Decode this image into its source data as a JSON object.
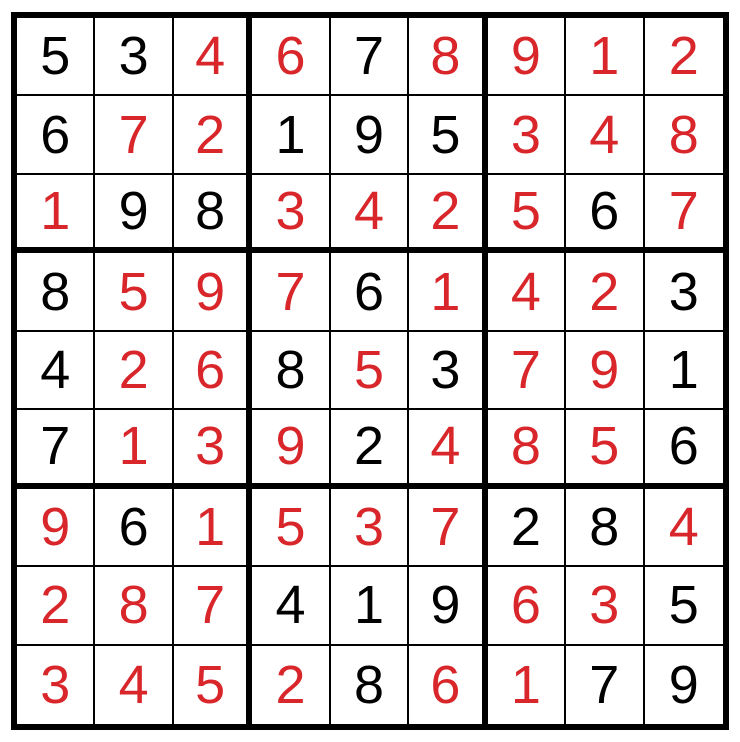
{
  "chart_data": {
    "type": "table",
    "title": "Sudoku Grid",
    "rows": [
      [
        {
          "v": 5,
          "given": true
        },
        {
          "v": 3,
          "given": true
        },
        {
          "v": 4,
          "given": false
        },
        {
          "v": 6,
          "given": false
        },
        {
          "v": 7,
          "given": true
        },
        {
          "v": 8,
          "given": false
        },
        {
          "v": 9,
          "given": false
        },
        {
          "v": 1,
          "given": false
        },
        {
          "v": 2,
          "given": false
        }
      ],
      [
        {
          "v": 6,
          "given": true
        },
        {
          "v": 7,
          "given": false
        },
        {
          "v": 2,
          "given": false
        },
        {
          "v": 1,
          "given": true
        },
        {
          "v": 9,
          "given": true
        },
        {
          "v": 5,
          "given": true
        },
        {
          "v": 3,
          "given": false
        },
        {
          "v": 4,
          "given": false
        },
        {
          "v": 8,
          "given": false
        }
      ],
      [
        {
          "v": 1,
          "given": false
        },
        {
          "v": 9,
          "given": true
        },
        {
          "v": 8,
          "given": true
        },
        {
          "v": 3,
          "given": false
        },
        {
          "v": 4,
          "given": false
        },
        {
          "v": 2,
          "given": false
        },
        {
          "v": 5,
          "given": false
        },
        {
          "v": 6,
          "given": true
        },
        {
          "v": 7,
          "given": false
        }
      ],
      [
        {
          "v": 8,
          "given": true
        },
        {
          "v": 5,
          "given": false
        },
        {
          "v": 9,
          "given": false
        },
        {
          "v": 7,
          "given": false
        },
        {
          "v": 6,
          "given": true
        },
        {
          "v": 1,
          "given": false
        },
        {
          "v": 4,
          "given": false
        },
        {
          "v": 2,
          "given": false
        },
        {
          "v": 3,
          "given": true
        }
      ],
      [
        {
          "v": 4,
          "given": true
        },
        {
          "v": 2,
          "given": false
        },
        {
          "v": 6,
          "given": false
        },
        {
          "v": 8,
          "given": true
        },
        {
          "v": 5,
          "given": false
        },
        {
          "v": 3,
          "given": true
        },
        {
          "v": 7,
          "given": false
        },
        {
          "v": 9,
          "given": false
        },
        {
          "v": 1,
          "given": true
        }
      ],
      [
        {
          "v": 7,
          "given": true
        },
        {
          "v": 1,
          "given": false
        },
        {
          "v": 3,
          "given": false
        },
        {
          "v": 9,
          "given": false
        },
        {
          "v": 2,
          "given": true
        },
        {
          "v": 4,
          "given": false
        },
        {
          "v": 8,
          "given": false
        },
        {
          "v": 5,
          "given": false
        },
        {
          "v": 6,
          "given": true
        }
      ],
      [
        {
          "v": 9,
          "given": false
        },
        {
          "v": 6,
          "given": true
        },
        {
          "v": 1,
          "given": false
        },
        {
          "v": 5,
          "given": false
        },
        {
          "v": 3,
          "given": false
        },
        {
          "v": 7,
          "given": false
        },
        {
          "v": 2,
          "given": true
        },
        {
          "v": 8,
          "given": true
        },
        {
          "v": 4,
          "given": false
        }
      ],
      [
        {
          "v": 2,
          "given": false
        },
        {
          "v": 8,
          "given": false
        },
        {
          "v": 7,
          "given": false
        },
        {
          "v": 4,
          "given": true
        },
        {
          "v": 1,
          "given": true
        },
        {
          "v": 9,
          "given": true
        },
        {
          "v": 6,
          "given": false
        },
        {
          "v": 3,
          "given": false
        },
        {
          "v": 5,
          "given": true
        }
      ],
      [
        {
          "v": 3,
          "given": false
        },
        {
          "v": 4,
          "given": false
        },
        {
          "v": 5,
          "given": false
        },
        {
          "v": 2,
          "given": false
        },
        {
          "v": 8,
          "given": true
        },
        {
          "v": 6,
          "given": false
        },
        {
          "v": 1,
          "given": false
        },
        {
          "v": 7,
          "given": true
        },
        {
          "v": 9,
          "given": true
        }
      ]
    ]
  }
}
